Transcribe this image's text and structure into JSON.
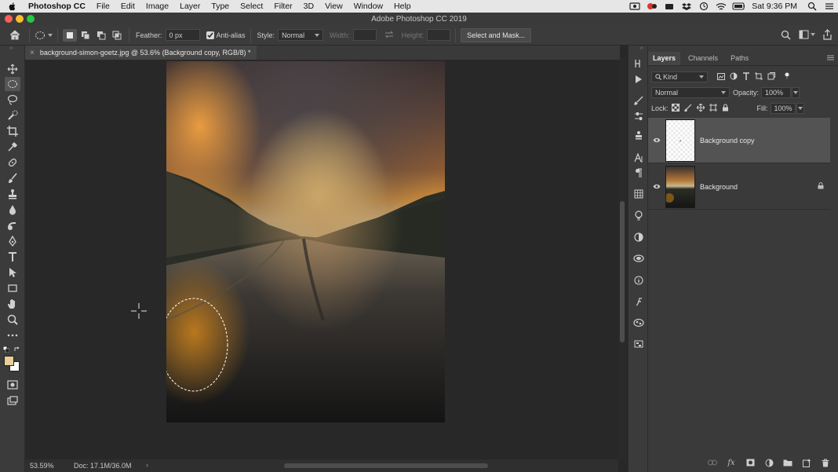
{
  "menubar": {
    "app_name": "Photoshop CC",
    "items": [
      "File",
      "Edit",
      "Image",
      "Layer",
      "Type",
      "Select",
      "Filter",
      "3D",
      "View",
      "Window",
      "Help"
    ],
    "clock": "Sat 9:36 PM"
  },
  "window": {
    "title": "Adobe Photoshop CC 2019"
  },
  "options": {
    "feather_label": "Feather:",
    "feather_value": "0 px",
    "antialias_label": "Anti-alias",
    "antialias_checked": true,
    "style_label": "Style:",
    "style_value": "Normal",
    "width_label": "Width:",
    "height_label": "Height:",
    "select_mask_label": "Select and Mask..."
  },
  "document": {
    "tab_title": "background-simon-goetz.jpg @ 53.6% (Background copy, RGB/8) *"
  },
  "status": {
    "zoom": "53.59%",
    "doc_size": "Doc: 17.1M/36.0M",
    "arrow": "›"
  },
  "layers_panel": {
    "tabs": [
      "Layers",
      "Channels",
      "Paths"
    ],
    "filter_kind": "Kind",
    "blend_mode": "Normal",
    "opacity_label": "Opacity:",
    "opacity_value": "100%",
    "lock_label": "Lock:",
    "fill_label": "Fill:",
    "fill_value": "100%",
    "layers": [
      {
        "name": "Background copy",
        "visible": true,
        "selected": true,
        "locked": false
      },
      {
        "name": "Background",
        "visible": true,
        "selected": false,
        "locked": true
      }
    ]
  },
  "colors": {
    "foreground": "#e8cf9a",
    "background": "#ffffff",
    "mac_red": "#fd5f57",
    "mac_yellow": "#febc2e",
    "mac_green": "#28c840"
  }
}
